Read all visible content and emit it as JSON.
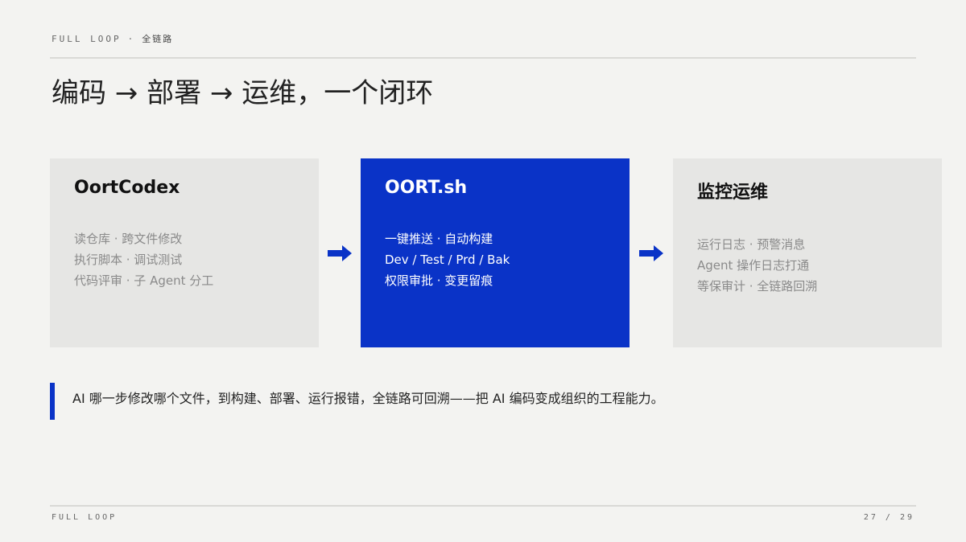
{
  "header": {
    "kicker_en": "FULL LOOP",
    "kicker_sep": "·",
    "kicker_cn": "全链路"
  },
  "title": "编码 → 部署 → 运维，一个闭环",
  "cards": [
    {
      "title": "OortCodex",
      "lines": [
        "读仓库 · 跨文件修改",
        "执行脚本 · 调试测试",
        "代码评审 · 子 Agent 分工"
      ]
    },
    {
      "title": "OORT.sh",
      "lines": [
        "一键推送 · 自动构建",
        "Dev / Test / Prd / Bak",
        "权限审批 · 变更留痕"
      ]
    },
    {
      "title": "监控运维",
      "lines": [
        "运行日志 · 预警消息",
        "Agent 操作日志打通",
        "等保审计 · 全链路回溯"
      ]
    }
  ],
  "arrows": [
    "arrow-right-icon",
    "arrow-right-icon"
  ],
  "quote": "AI 哪一步修改哪个文件，到构建、部署、运行报错，全链路可回溯——把 AI 编码变成组织的工程能力。",
  "footer": {
    "label": "FULL LOOP",
    "page": "27 / 29"
  },
  "colors": {
    "background": "#f3f3f1",
    "accent": "#0a33c7",
    "card": "#e6e6e4"
  }
}
